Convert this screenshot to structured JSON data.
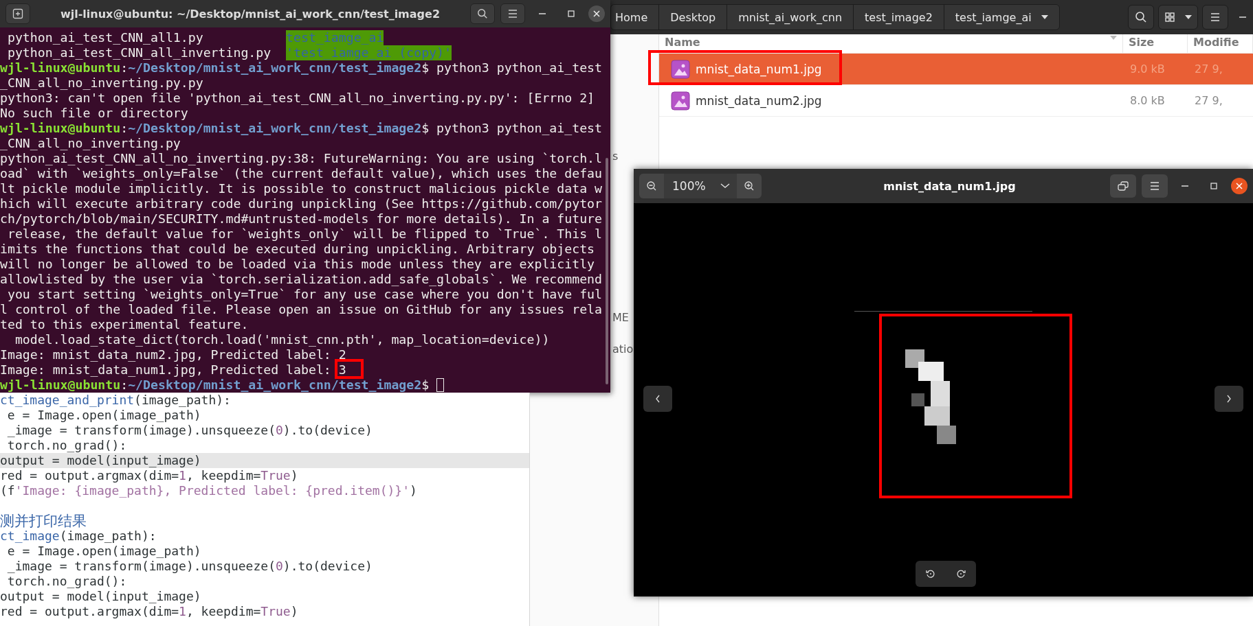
{
  "terminal": {
    "title": "wjl-linux@ubuntu: ~/Desktop/mnist_ai_work_cnn/test_image2",
    "lines": [
      {
        "kind": "ls",
        "name": " python_ai_test_CNN_all1.py",
        "dir": "test_iamge_ai"
      },
      {
        "kind": "ls",
        "name": " python_ai_test_CNN_all_inverting.py",
        "dir": "'test_iamge_ai (copy)'"
      },
      {
        "kind": "prompt",
        "user": "wjl-linux@ubuntu",
        "colon": ":",
        "path": "~/Desktop/mnist_ai_work_cnn/test_image2",
        "command": "$ python3 python_ai_test",
        "cursor": false
      },
      {
        "kind": "output",
        "text": "_CNN_all_no_inverting.py.py"
      },
      {
        "kind": "output",
        "text": "python3: can't open file 'python_ai_test_CNN_all_no_inverting.py.py': [Errno 2]"
      },
      {
        "kind": "output",
        "text": "No such file or directory"
      },
      {
        "kind": "prompt",
        "user": "wjl-linux@ubuntu",
        "colon": ":",
        "path": "~/Desktop/mnist_ai_work_cnn/test_image2",
        "command": "$ python3 python_ai_test",
        "cursor": false
      },
      {
        "kind": "output",
        "text": "_CNN_all_no_inverting.py"
      },
      {
        "kind": "output",
        "text": "python_ai_test_CNN_all_no_inverting.py:38: FutureWarning: You are using `torch.l"
      },
      {
        "kind": "output",
        "text": "oad` with `weights_only=False` (the current default value), which uses the defau"
      },
      {
        "kind": "output",
        "text": "lt pickle module implicitly. It is possible to construct malicious pickle data w"
      },
      {
        "kind": "output",
        "text": "hich will execute arbitrary code during unpickling (See https://github.com/pytor"
      },
      {
        "kind": "output",
        "text": "ch/pytorch/blob/main/SECURITY.md#untrusted-models for more details). In a future"
      },
      {
        "kind": "output",
        "text": " release, the default value for `weights_only` will be flipped to `True`. This l"
      },
      {
        "kind": "output",
        "text": "imits the functions that could be executed during unpickling. Arbitrary objects"
      },
      {
        "kind": "output",
        "text": "will no longer be allowed to be loaded via this mode unless they are explicitly"
      },
      {
        "kind": "output",
        "text": "allowlisted by the user via `torch.serialization.add_safe_globals`. We recommend"
      },
      {
        "kind": "output",
        "text": " you start setting `weights_only=True` for any use case where you don't have ful"
      },
      {
        "kind": "output",
        "text": "l control of the loaded file. Please open an issue on GitHub for any issues rela"
      },
      {
        "kind": "output",
        "text": "ted to this experimental feature."
      },
      {
        "kind": "output",
        "text": "  model.load_state_dict(torch.load('mnist_cnn.pth', map_location=device))"
      },
      {
        "kind": "output",
        "text": "Image: mnist_data_num2.jpg, Predicted label: 2"
      },
      {
        "kind": "output",
        "text": "Image: mnist_data_num1.jpg, Predicted label: 3"
      },
      {
        "kind": "prompt",
        "user": "wjl-linux@ubuntu",
        "colon": ":",
        "path": "~/Desktop/mnist_ai_work_cnn/test_image2",
        "command": "$ ",
        "cursor": true
      }
    ]
  },
  "editor": {
    "lines": [
      {
        "current": false,
        "tokens": [
          {
            "kind": "func",
            "text": "ct_image_and_print"
          },
          {
            "kind": "plain",
            "text": "(image_path):"
          }
        ]
      },
      {
        "current": false,
        "tokens": [
          {
            "kind": "plain",
            "text": " e = Image.open(image_path)"
          }
        ]
      },
      {
        "current": false,
        "tokens": [
          {
            "kind": "plain",
            "text": " _image = transform(image).unsqueeze("
          },
          {
            "kind": "num",
            "text": "0"
          },
          {
            "kind": "plain",
            "text": ").to(device)"
          }
        ]
      },
      {
        "current": false,
        "tokens": [
          {
            "kind": "plain",
            "text": " torch.no_grad():"
          }
        ]
      },
      {
        "current": true,
        "tokens": [
          {
            "kind": "plain",
            "text": "output = model(input_image)"
          }
        ]
      },
      {
        "current": false,
        "tokens": [
          {
            "kind": "plain",
            "text": "red = output.argmax(dim="
          },
          {
            "kind": "num",
            "text": "1"
          },
          {
            "kind": "plain",
            "text": ", keepdim="
          },
          {
            "kind": "num",
            "text": "True"
          },
          {
            "kind": "plain",
            "text": ")"
          }
        ]
      },
      {
        "current": false,
        "tokens": [
          {
            "kind": "plain",
            "text": "(f"
          },
          {
            "kind": "str",
            "text": "'Image: {image_path}, Predicted label: {pred.item()}'"
          },
          {
            "kind": "plain",
            "text": ")"
          }
        ]
      },
      {
        "current": false
      },
      {
        "current": false,
        "tokens": [
          {
            "kind": "comment",
            "text": "测并打印结果"
          }
        ]
      },
      {
        "current": false,
        "tokens": [
          {
            "kind": "func",
            "text": "ct_image"
          },
          {
            "kind": "plain",
            "text": "(image_path):"
          }
        ]
      },
      {
        "current": false,
        "tokens": [
          {
            "kind": "plain",
            "text": " e = Image.open(image_path)"
          }
        ]
      },
      {
        "current": false,
        "tokens": [
          {
            "kind": "plain",
            "text": " _image = transform(image).unsqueeze("
          },
          {
            "kind": "num",
            "text": "0"
          },
          {
            "kind": "plain",
            "text": ").to(device)"
          }
        ]
      },
      {
        "current": false,
        "tokens": [
          {
            "kind": "plain",
            "text": " torch.no_grad():"
          }
        ]
      },
      {
        "current": false,
        "tokens": [
          {
            "kind": "plain",
            "text": "output = model(input_image)"
          }
        ]
      },
      {
        "current": false,
        "tokens": [
          {
            "kind": "plain",
            "text": "red = output.argmax(dim="
          },
          {
            "kind": "num",
            "text": "1"
          },
          {
            "kind": "plain",
            "text": ", keepdim="
          },
          {
            "kind": "num",
            "text": "True"
          },
          {
            "kind": "plain",
            "text": ")"
          }
        ]
      }
    ]
  },
  "file_manager": {
    "path": [
      {
        "label": "Home",
        "menu": false
      },
      {
        "label": "Desktop",
        "menu": false
      },
      {
        "label": "mnist_ai_work_cnn",
        "menu": false
      },
      {
        "label": "test_image2",
        "menu": false
      },
      {
        "label": "test_iamge_ai",
        "menu": true
      }
    ],
    "sidebar": [
      "s",
      "ME",
      "atio"
    ],
    "columns": [
      "Name",
      "Size",
      "Modifie"
    ],
    "files": [
      {
        "name": "mnist_data_num1.jpg",
        "size": "9.0 kB",
        "modified": "27 9,",
        "selected": true
      },
      {
        "name": "mnist_data_num2.jpg",
        "size": "8.0 kB",
        "modified": "27 9,",
        "selected": false
      }
    ]
  },
  "viewer": {
    "zoom": "100%",
    "title": "mnist_data_num1.jpg"
  }
}
